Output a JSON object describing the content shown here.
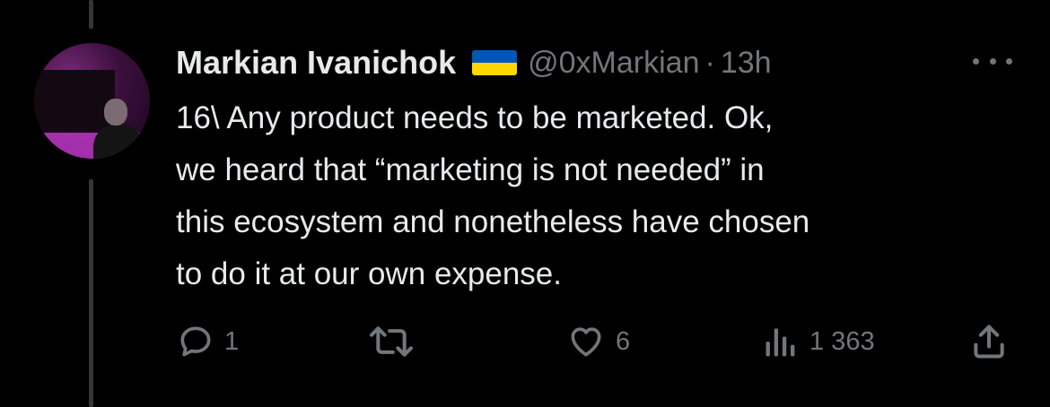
{
  "tweet": {
    "author_name": "Markian Ivanichok",
    "flag_icon": "ukraine-flag-icon",
    "handle": "@0xMarkian",
    "separator": "·",
    "time": "13h",
    "text_lines": [
      "16\\ Any product needs to be marketed. Ok,",
      "we heard that “marketing is not needed” in",
      "this ecosystem and nonetheless have chosen",
      "to do it at our own expense."
    ]
  },
  "actions": {
    "reply": {
      "icon": "reply-icon",
      "count": "1"
    },
    "retweet": {
      "icon": "retweet-icon",
      "count": ""
    },
    "like": {
      "icon": "heart-icon",
      "count": "6"
    },
    "views": {
      "icon": "views-icon",
      "count": "1 363"
    },
    "share": {
      "icon": "share-icon"
    }
  },
  "colors": {
    "background": "#000000",
    "text": "#e7e9ea",
    "muted": "#71767b",
    "thread_line": "#333639",
    "flag_blue": "#0057b7",
    "flag_yellow": "#ffd700"
  }
}
